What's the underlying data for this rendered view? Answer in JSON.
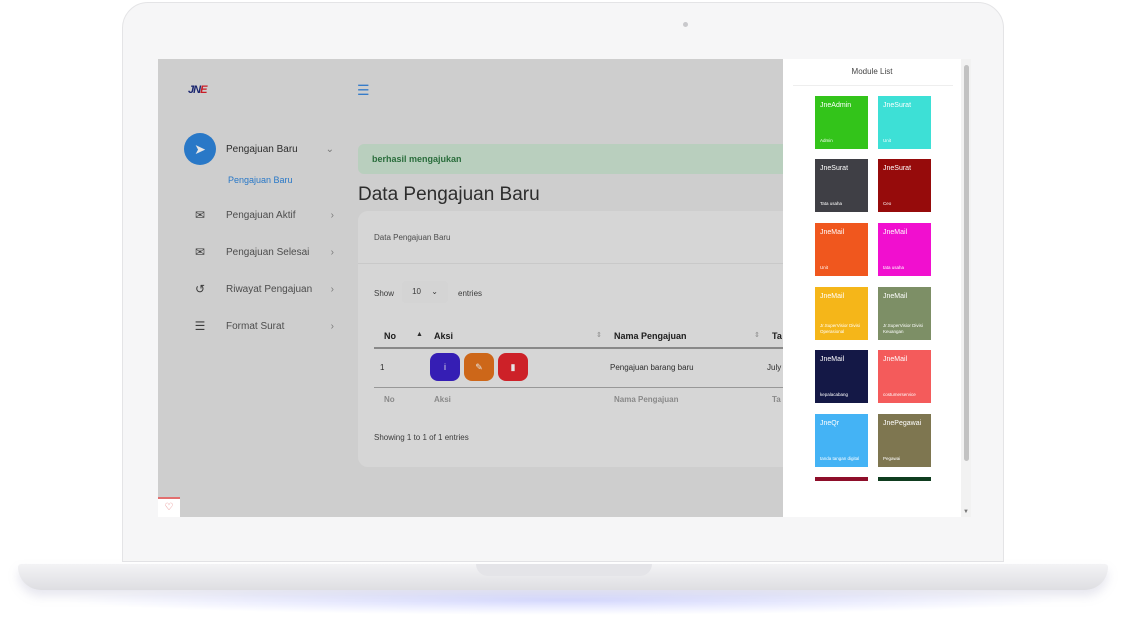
{
  "sidebar": {
    "logo": {
      "text_1": "JN",
      "text_2": "E"
    },
    "items": [
      {
        "label": "Pengajuan Baru",
        "icon": "paper-plane-icon",
        "active": true
      },
      {
        "label": "Pengajuan Aktif",
        "icon": "mail-cog-icon"
      },
      {
        "label": "Pengajuan Selesai",
        "icon": "envelope-open-icon"
      },
      {
        "label": "Riwayat Pengajuan",
        "icon": "history-icon"
      },
      {
        "label": "Format Surat",
        "icon": "indent-list-icon"
      }
    ],
    "sub_item": "Pengajuan Baru"
  },
  "alert": {
    "text": "berhasil mengajukan",
    "color": "#cfe7d4"
  },
  "page": {
    "title": "Data Pengajuan Baru"
  },
  "card": {
    "header": "Data Pengajuan Baru",
    "show_label": "Show",
    "page_size": "10",
    "entries_label": "entries",
    "columns": [
      "No",
      "Aksi",
      "Nama Pengajuan",
      "Ta"
    ],
    "rows": [
      {
        "no": "1",
        "nama": "Pengajuan barang baru",
        "tanggal": "July"
      }
    ],
    "footer_columns": [
      "No",
      "Aksi",
      "Nama Pengajuan",
      "Ta"
    ],
    "showing": "Showing 1 to 1 of 1 entries",
    "action_colors": {
      "info": "#3b22c9",
      "edit": "#e5731c",
      "delete": "#e5252d"
    }
  },
  "modules": {
    "title": "Module List",
    "tiles": [
      {
        "name": "JneAdmin",
        "sub": "Admin",
        "color": "#33c41a"
      },
      {
        "name": "JneSurat",
        "sub": "Unit",
        "color": "#3de0d6"
      },
      {
        "name": "JneSurat",
        "sub": "Tata usaha",
        "color": "#3f3f45"
      },
      {
        "name": "JneSurat",
        "sub": "Ceo",
        "color": "#960b0b"
      },
      {
        "name": "JneMail",
        "sub": "Unit",
        "color": "#f0571e"
      },
      {
        "name": "JneMail",
        "sub": "tata usaha",
        "color": "#f10fcf"
      },
      {
        "name": "JneMail",
        "sub": "Jr.SuperVisior Divisi Operasional",
        "color": "#f5b619"
      },
      {
        "name": "JneMail",
        "sub": "Jr.SuperVisior Divisi Keuangan",
        "color": "#7d8f66"
      },
      {
        "name": "JneMail",
        "sub": "kepalacabang",
        "color": "#141846"
      },
      {
        "name": "JneMail",
        "sub": "costumerservice",
        "color": "#f45b5b"
      },
      {
        "name": "JneQr",
        "sub": "tanda tangan digital",
        "color": "#44b3f5"
      },
      {
        "name": "JnePegawai",
        "sub": "Pegawai",
        "color": "#7e7650"
      }
    ]
  }
}
